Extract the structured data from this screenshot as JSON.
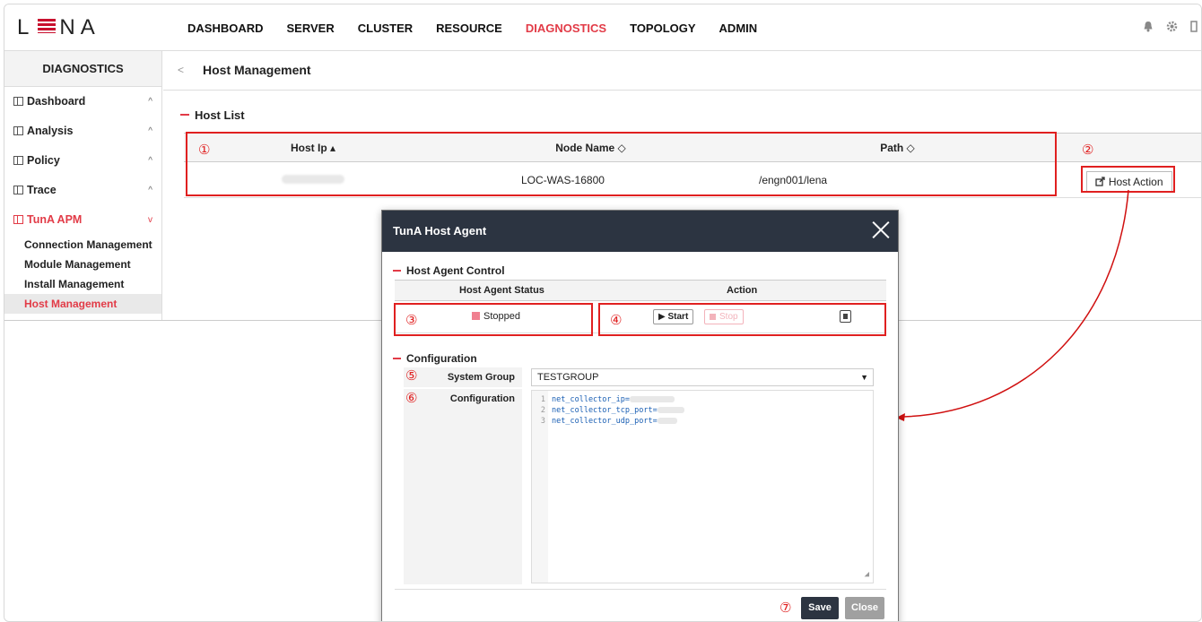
{
  "logo": {
    "left": "L",
    "right": "NA"
  },
  "nav": {
    "items": [
      {
        "label": "DASHBOARD"
      },
      {
        "label": "SERVER"
      },
      {
        "label": "CLUSTER"
      },
      {
        "label": "RESOURCE"
      },
      {
        "label": "DIAGNOSTICS",
        "active": true
      },
      {
        "label": "TOPOLOGY"
      },
      {
        "label": "ADMIN"
      }
    ],
    "icons": [
      "bell-icon",
      "gear-icon",
      "logout-icon"
    ]
  },
  "sidebar": {
    "title": "DIAGNOSTICS",
    "items": [
      {
        "label": "Dashboard",
        "chevron": "^"
      },
      {
        "label": "Analysis",
        "chevron": "^"
      },
      {
        "label": "Policy",
        "chevron": "^"
      },
      {
        "label": "Trace",
        "chevron": "^"
      },
      {
        "label": "TunA APM",
        "chevron": "v"
      }
    ],
    "sub_items": [
      {
        "label": "Connection Management"
      },
      {
        "label": "Module Management"
      },
      {
        "label": "Install Management"
      },
      {
        "label": "Host Management",
        "active": true
      }
    ]
  },
  "page": {
    "back": "<",
    "title": "Host Management",
    "host_list_title": "Host List",
    "columns": {
      "host_ip": "Host Ip ▴",
      "node_name": "Node Name ◇",
      "path": "Path ◇"
    },
    "rows": [
      {
        "node_name": "LOC-WAS-16800",
        "path": "/engn001/lena"
      }
    ],
    "host_action_label": "Host Action"
  },
  "annotations": [
    "①",
    "②",
    "③",
    "④",
    "⑤",
    "⑥",
    "⑦"
  ],
  "modal": {
    "title": "TunA Host Agent",
    "control_title": "Host Agent Control",
    "status_header": "Host Agent Status",
    "action_header": "Action",
    "status": "Stopped",
    "start_label": "Start",
    "stop_label": "Stop",
    "configuration_title": "Configuration",
    "system_group_label": "System Group",
    "system_group_value": "TESTGROUP",
    "configuration_label": "Configuration",
    "config_lines": [
      {
        "no": "1",
        "text": "net_collector_ip="
      },
      {
        "no": "2",
        "text": "net_collector_tcp_port="
      },
      {
        "no": "3",
        "text": "net_collector_udp_port="
      }
    ],
    "save_label": "Save",
    "close_label": "Close"
  },
  "colors": {
    "accent": "#e23b47",
    "modal_header": "#2c3441",
    "annotation": "#e02020",
    "save": "#2c3441",
    "close": "#a0a0a0"
  }
}
